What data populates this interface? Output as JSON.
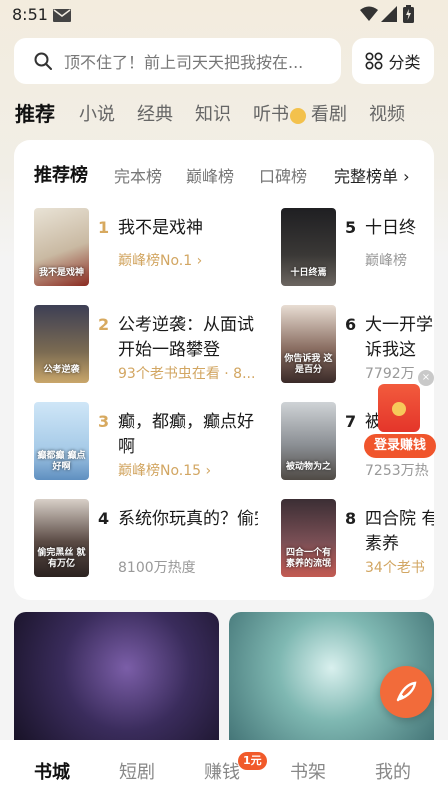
{
  "status_bar": {
    "time": "8:51"
  },
  "search": {
    "placeholder": "顶不住了！前上司天天把我按在..."
  },
  "category_button": {
    "label": "分类"
  },
  "channel_tabs": [
    "推荐",
    "小说",
    "经典",
    "知识",
    "听书",
    "看剧",
    "视频"
  ],
  "rank_tabs": [
    "推荐榜",
    "完本榜",
    "巅峰榜",
    "口碑榜"
  ],
  "full_list": "完整榜单 ›",
  "books": [
    {
      "rank": "1",
      "title": "我不是戏神",
      "meta": "巅峰榜No.1 ›",
      "cover_text": "我不是戏神"
    },
    {
      "rank": "2",
      "title": "公考逆袭：从面试开始一路攀登",
      "meta": "93个老书虫在看 · 8...",
      "cover_text": "公考逆袭"
    },
    {
      "rank": "3",
      "title": "癫，都癫，癫点好啊",
      "meta": "巅峰榜No.15 ›",
      "cover_text": "癫都癫 癫点好啊"
    },
    {
      "rank": "4",
      "title": "系统你玩真的？偷完黑丝就有万...",
      "meta": "8100万热度",
      "cover_text": "偷完黑丝 就有万亿"
    },
    {
      "rank": "5",
      "title": "十日终",
      "meta": "巅峰榜",
      "cover_text": "十日终焉"
    },
    {
      "rank": "6",
      "title": "大一开学 诉我这",
      "meta": "7792万",
      "cover_text": "你告诉我 这是百分"
    },
    {
      "rank": "7",
      "title": "被",
      "meta": "7253万热",
      "cover_text": "被动物为之"
    },
    {
      "rank": "8",
      "title": "四合院 有素养",
      "meta": "34个老书",
      "cover_text": "四合一个有 素养的流氓"
    }
  ],
  "float_widget": {
    "label": "登录赚钱",
    "close": "×"
  },
  "bottom_nav": [
    "书城",
    "短剧",
    "赚钱",
    "书架",
    "我的"
  ],
  "nav_badge": "1元"
}
